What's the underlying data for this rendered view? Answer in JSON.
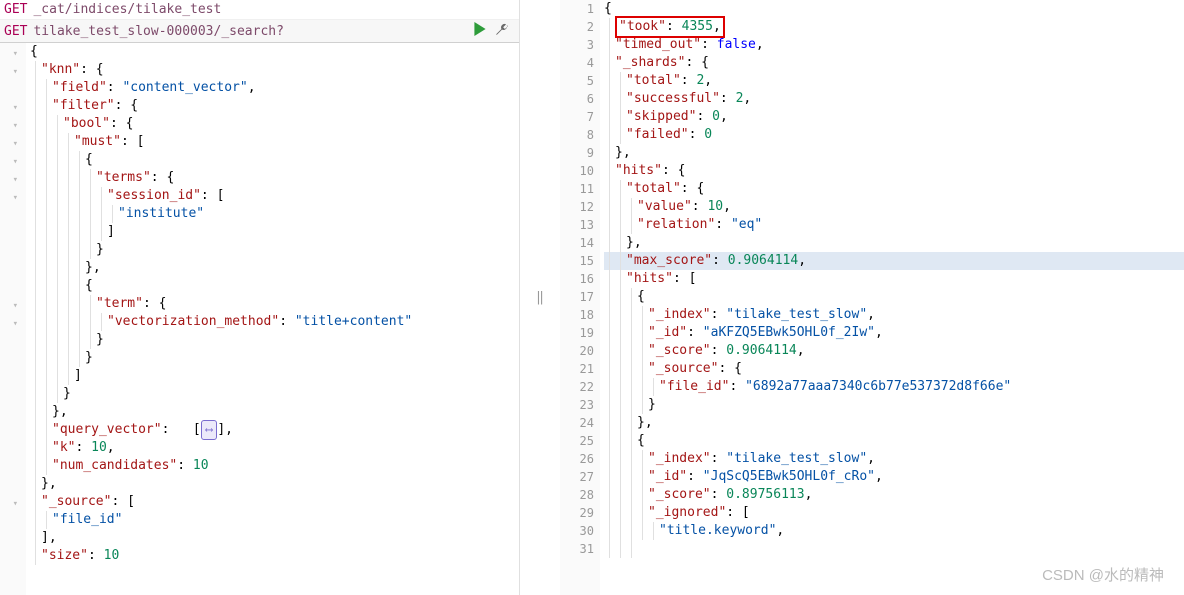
{
  "header": {
    "line1_method": "GET",
    "line1_path": "_cat/indices/tilake_test",
    "line2_method": "GET",
    "line2_path": "tilake_test_slow-000003/_search?"
  },
  "request": {
    "l1": "{",
    "knn_key": "\"knn\"",
    "knn_v": ": {",
    "field_key": "\"field\"",
    "field_v": ": ",
    "field_s": "\"content_vector\"",
    "filter_key": "\"filter\"",
    "filter_v": ": {",
    "bool_key": "\"bool\"",
    "bool_v": ": {",
    "must_key": "\"must\"",
    "must_v": ": [",
    "obj_open": "{",
    "terms_key": "\"terms\"",
    "terms_v": ": {",
    "session_key": "\"session_id\"",
    "session_v": ": [",
    "institute": "\"institute\"",
    "arr_close": "]",
    "obj_close": "}",
    "term_key": "\"term\"",
    "term_v": ": {",
    "vec_key": "\"vectorization_method\"",
    "vec_v": ": ",
    "vec_s": "\"title+content\"",
    "qv_key": "\"query_vector\"",
    "qv_colon": ":   [",
    "qv_close": "],",
    "qv_badge": "⟷",
    "k_key": "\"k\"",
    "k_n": "10",
    "numc_key": "\"num_candidates\"",
    "numc_n": "10",
    "src_key": "\"_source\"",
    "src_v": ": [",
    "fileid_s": "\"file_id\"",
    "size_key": "\"size\"",
    "size_n": "10"
  },
  "response": {
    "lines": [
      {
        "ln": "1",
        "fold": true,
        "content": [
          [
            "pn",
            "{"
          ]
        ]
      },
      {
        "ln": "2",
        "fold": false,
        "content": [
          [
            "redbox_start",
            ""
          ],
          [
            "k",
            "\"took\""
          ],
          [
            "pn",
            ": "
          ],
          [
            "n",
            "4355"
          ],
          [
            "pn",
            ","
          ],
          [
            "redbox_end",
            ""
          ]
        ]
      },
      {
        "ln": "3",
        "fold": false,
        "content": [
          [
            "k",
            "\"timed_out\""
          ],
          [
            "pn",
            ": "
          ],
          [
            "b",
            "false"
          ],
          [
            "pn",
            ","
          ]
        ]
      },
      {
        "ln": "4",
        "fold": true,
        "content": [
          [
            "k",
            "\"_shards\""
          ],
          [
            "pn",
            ": {"
          ]
        ]
      },
      {
        "ln": "5",
        "fold": false,
        "content": [
          [
            "k",
            "\"total\""
          ],
          [
            "pn",
            ": "
          ],
          [
            "n",
            "2"
          ],
          [
            "pn",
            ","
          ]
        ]
      },
      {
        "ln": "6",
        "fold": false,
        "content": [
          [
            "k",
            "\"successful\""
          ],
          [
            "pn",
            ": "
          ],
          [
            "n",
            "2"
          ],
          [
            "pn",
            ","
          ]
        ]
      },
      {
        "ln": "7",
        "fold": false,
        "content": [
          [
            "k",
            "\"skipped\""
          ],
          [
            "pn",
            ": "
          ],
          [
            "n",
            "0"
          ],
          [
            "pn",
            ","
          ]
        ]
      },
      {
        "ln": "8",
        "fold": false,
        "content": [
          [
            "k",
            "\"failed\""
          ],
          [
            "pn",
            ": "
          ],
          [
            "n",
            "0"
          ]
        ]
      },
      {
        "ln": "9",
        "fold": true,
        "content": [
          [
            "pn",
            "},"
          ]
        ]
      },
      {
        "ln": "10",
        "fold": true,
        "content": [
          [
            "k",
            "\"hits\""
          ],
          [
            "pn",
            ": {"
          ]
        ]
      },
      {
        "ln": "11",
        "fold": true,
        "content": [
          [
            "k",
            "\"total\""
          ],
          [
            "pn",
            ": {"
          ]
        ]
      },
      {
        "ln": "12",
        "fold": false,
        "content": [
          [
            "k",
            "\"value\""
          ],
          [
            "pn",
            ": "
          ],
          [
            "n",
            "10"
          ],
          [
            "pn",
            ","
          ]
        ]
      },
      {
        "ln": "13",
        "fold": false,
        "content": [
          [
            "k",
            "\"relation\""
          ],
          [
            "pn",
            ": "
          ],
          [
            "s",
            "\"eq\""
          ]
        ]
      },
      {
        "ln": "14",
        "fold": true,
        "content": [
          [
            "pn",
            "},"
          ]
        ]
      },
      {
        "ln": "15",
        "fold": false,
        "hl": true,
        "content": [
          [
            "k",
            "\"max_score\""
          ],
          [
            "pn",
            ": "
          ],
          [
            "n",
            "0.9064114"
          ],
          [
            "pn",
            ","
          ]
        ]
      },
      {
        "ln": "16",
        "fold": true,
        "content": [
          [
            "k",
            "\"hits\""
          ],
          [
            "pn",
            ": ["
          ]
        ]
      },
      {
        "ln": "17",
        "fold": true,
        "content": [
          [
            "pn",
            "{"
          ]
        ]
      },
      {
        "ln": "18",
        "fold": false,
        "content": [
          [
            "k",
            "\"_index\""
          ],
          [
            "pn",
            ": "
          ],
          [
            "s",
            "\"tilake_test_slow\""
          ],
          [
            "pn",
            ","
          ]
        ]
      },
      {
        "ln": "19",
        "fold": false,
        "content": [
          [
            "k",
            "\"_id\""
          ],
          [
            "pn",
            ": "
          ],
          [
            "s",
            "\"aKFZQ5EBwk5OHL0f_2Iw\""
          ],
          [
            "pn",
            ","
          ]
        ]
      },
      {
        "ln": "20",
        "fold": false,
        "content": [
          [
            "k",
            "\"_score\""
          ],
          [
            "pn",
            ": "
          ],
          [
            "n",
            "0.9064114"
          ],
          [
            "pn",
            ","
          ]
        ]
      },
      {
        "ln": "21",
        "fold": true,
        "content": [
          [
            "k",
            "\"_source\""
          ],
          [
            "pn",
            ": {"
          ]
        ]
      },
      {
        "ln": "22",
        "fold": false,
        "content": [
          [
            "k",
            "\"file_id\""
          ],
          [
            "pn",
            ": "
          ],
          [
            "s",
            "\"6892a77aaa7340c6b77e537372d8f66e\""
          ]
        ]
      },
      {
        "ln": "23",
        "fold": true,
        "content": [
          [
            "pn",
            "}"
          ]
        ]
      },
      {
        "ln": "24",
        "fold": true,
        "content": [
          [
            "pn",
            "},"
          ]
        ]
      },
      {
        "ln": "25",
        "fold": true,
        "content": [
          [
            "pn",
            "{"
          ]
        ]
      },
      {
        "ln": "26",
        "fold": false,
        "content": [
          [
            "k",
            "\"_index\""
          ],
          [
            "pn",
            ": "
          ],
          [
            "s",
            "\"tilake_test_slow\""
          ],
          [
            "pn",
            ","
          ]
        ]
      },
      {
        "ln": "27",
        "fold": false,
        "content": [
          [
            "k",
            "\"_id\""
          ],
          [
            "pn",
            ": "
          ],
          [
            "s",
            "\"JqScQ5EBwk5OHL0f_cRo\""
          ],
          [
            "pn",
            ","
          ]
        ]
      },
      {
        "ln": "28",
        "fold": false,
        "content": [
          [
            "k",
            "\"_score\""
          ],
          [
            "pn",
            ": "
          ],
          [
            "n",
            "0.89756113"
          ],
          [
            "pn",
            ","
          ]
        ]
      },
      {
        "ln": "29",
        "fold": true,
        "content": [
          [
            "k",
            "\"_ignored\""
          ],
          [
            "pn",
            ": ["
          ]
        ]
      },
      {
        "ln": "30",
        "fold": false,
        "content": [
          [
            "s",
            "\"title.keyword\""
          ],
          [
            "pn",
            ","
          ]
        ]
      },
      {
        "ln": "31",
        "fold": true,
        "content": [
          [
            "pn",
            ""
          ]
        ]
      }
    ],
    "indent": [
      0,
      1,
      1,
      1,
      2,
      2,
      2,
      2,
      1,
      1,
      2,
      3,
      3,
      2,
      2,
      2,
      3,
      4,
      4,
      4,
      4,
      5,
      4,
      3,
      3,
      4,
      4,
      4,
      4,
      5,
      3
    ]
  },
  "watermark": "CSDN @水的精神"
}
